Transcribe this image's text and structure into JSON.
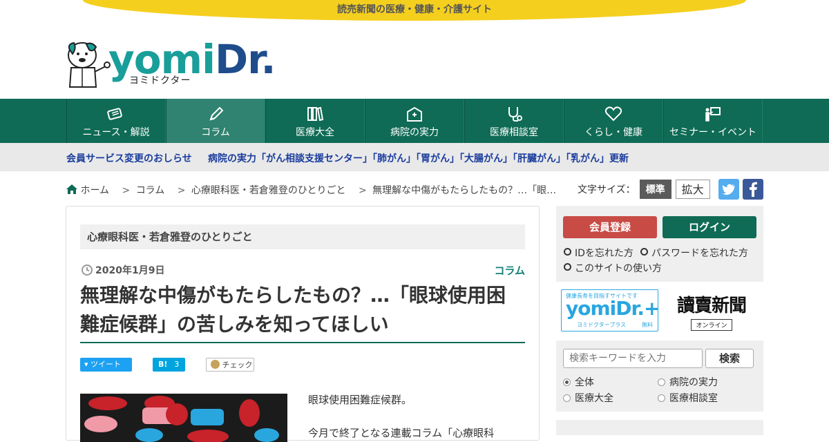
{
  "banner": "読売新聞の医療・健康・介護サイト",
  "logo": {
    "main": "yomi",
    "dr": "Dr.",
    "sub": "ヨミドクター"
  },
  "nav": [
    {
      "label": "ニュース・解説"
    },
    {
      "label": "コラム"
    },
    {
      "label": "医療大全"
    },
    {
      "label": "病院の実力"
    },
    {
      "label": "医療相談室"
    },
    {
      "label": "くらし・健康"
    },
    {
      "label": "セミナー・イベント"
    }
  ],
  "notices": [
    "会員サービス変更のおしらせ",
    "病院の実力「がん相談支援センター」「肺がん」「胃がん」「大腸がん」「肝臓がん」「乳がん」更新"
  ],
  "breadcrumb": [
    "ホーム",
    "コラム",
    "心療眼科医・若倉雅登のひとりごと",
    "無理解な中傷がもたらしたもの？…「眼…"
  ],
  "font_size": {
    "label": "文字サイズ：",
    "standard": "標準",
    "large": "拡大"
  },
  "article": {
    "category_box": "心療眼科医・若倉雅登のひとりごと",
    "date": "2020年1月9日",
    "category": "コラム",
    "title_line1": "無理解な中傷がもたらしたもの？…「眼球使用困",
    "title_line2": "難症候群」の苦しみを知ってほしい",
    "share": {
      "tweet": "ツイート",
      "hatena": "B!",
      "hatena_count": "3",
      "check": "チェック"
    },
    "body_line1": "眼球使用困難症候群。",
    "body_line2": "今月で終了となる連載コラム「心療眼科"
  },
  "sidebar": {
    "register": "会員登録",
    "login": "ログイン",
    "forgot_id": "IDを忘れた方",
    "forgot_password": "パスワードを忘れた方",
    "how_to_use": "このサイトの使い方",
    "plus_tagline": "健康長寿を目指すサイトです",
    "plus_logo": "yomiDr.+",
    "plus_sub": "ヨミドクタープラス",
    "plus_free": "無料",
    "yomiuri": "讀賣新聞",
    "yomiuri_online": "オンライン",
    "search_placeholder": "検索キーワードを入力",
    "search_button": "検索",
    "search_scopes": [
      "全体",
      "病院の実力",
      "医療大全",
      "医療相談室"
    ]
  },
  "colors": {
    "nav": "#0f6b55",
    "register": "#c84b45",
    "login": "#0f6b55",
    "banner": "#f5cf1e",
    "link": "#1a3c9e"
  }
}
